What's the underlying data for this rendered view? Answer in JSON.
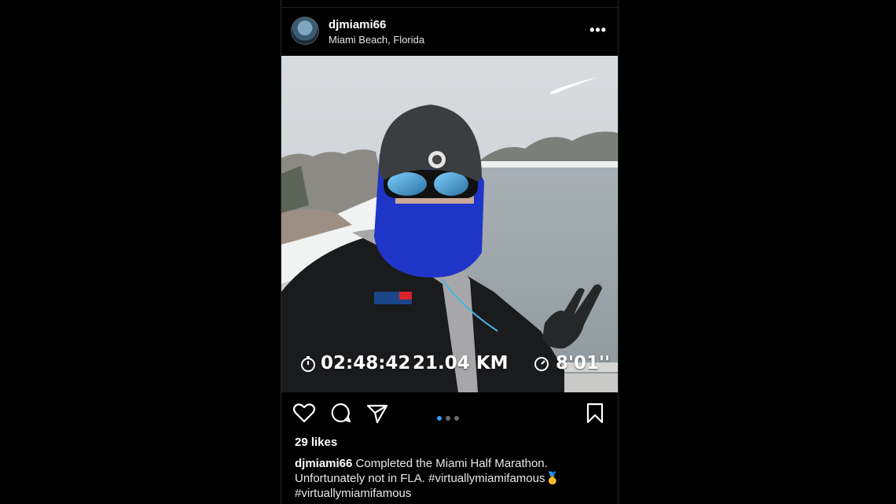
{
  "post": {
    "username": "djmiami66",
    "location": "Miami Beach, Florida",
    "more_label": "•••",
    "likes": "29 likes",
    "caption": {
      "user": "djmiami66",
      "text_1": "Completed the Miami Half Marathon. Unfortunately not in FLA.",
      "hashtag_1": "#virtuallymiamifamous",
      "emoji": "🥇",
      "hashtag_2": "#virtuallymiamifamous"
    }
  },
  "photo_overlay": {
    "time": "02:48:42",
    "distance": "21.04 KM",
    "pace": "8'01''",
    "brand_logo": "nike-swoosh"
  },
  "carousel": {
    "total": 3,
    "active": 1
  },
  "icons": {
    "like": "heart-icon",
    "comment": "comment-icon",
    "share": "share-icon",
    "save": "bookmark-icon",
    "avatar": "avatar",
    "stopwatch": "stopwatch-icon",
    "pace": "pace-gauge-icon"
  },
  "colors": {
    "background": "#000000",
    "carousel_active": "#3797f0",
    "carousel_inactive": "#6b6b6b"
  }
}
